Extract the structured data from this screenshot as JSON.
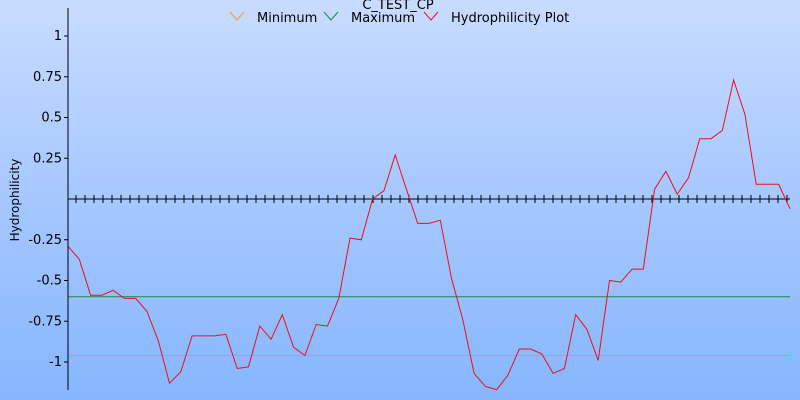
{
  "chart_data": {
    "type": "line",
    "title": "C_TEST_CP",
    "ylabel": "Hydrophilicity",
    "xlabel": "",
    "ylim": [
      -1.16,
      1.16
    ],
    "yticks": [
      {
        "value": 1,
        "label": "1"
      },
      {
        "value": 0.75,
        "label": "0.75"
      },
      {
        "value": 0.5,
        "label": "0.5"
      },
      {
        "value": 0.25,
        "label": "0.25"
      },
      {
        "value": -0.25,
        "label": "-0.25"
      },
      {
        "value": -0.5,
        "label": "-0.5"
      },
      {
        "value": -0.75,
        "label": "-0.75"
      },
      {
        "value": -1,
        "label": "-1"
      }
    ],
    "legend_position": "top-center",
    "series": [
      {
        "name": "Minimum",
        "color": "#e8a317",
        "kind": "hline",
        "value": -0.96
      },
      {
        "name": "Maximum",
        "color": "#1a8a3a",
        "kind": "hline",
        "value": -0.6
      },
      {
        "name": "Hydrophilicity Plot",
        "color": "#ee1010",
        "kind": "line",
        "values": [
          -0.29,
          -0.37,
          -0.59,
          -0.59,
          -0.56,
          -0.61,
          -0.61,
          -0.69,
          -0.87,
          -1.13,
          -1.06,
          -0.84,
          -0.84,
          -0.84,
          -0.83,
          -1.04,
          -1.03,
          -0.78,
          -0.86,
          -0.71,
          -0.91,
          -0.96,
          -0.77,
          -0.78,
          -0.61,
          -0.24,
          -0.25,
          0.0,
          0.05,
          0.27,
          0.06,
          -0.15,
          -0.15,
          -0.13,
          -0.49,
          -0.74,
          -1.07,
          -1.15,
          -1.17,
          -1.08,
          -0.92,
          -0.92,
          -0.95,
          -1.07,
          -1.04,
          -0.71,
          -0.8,
          -0.99,
          -0.5,
          -0.51,
          -0.43,
          -0.43,
          0.06,
          0.17,
          0.03,
          0.13,
          0.37,
          0.37,
          0.42,
          0.73,
          0.52,
          0.09,
          0.09,
          0.09,
          -0.06
        ]
      }
    ]
  }
}
